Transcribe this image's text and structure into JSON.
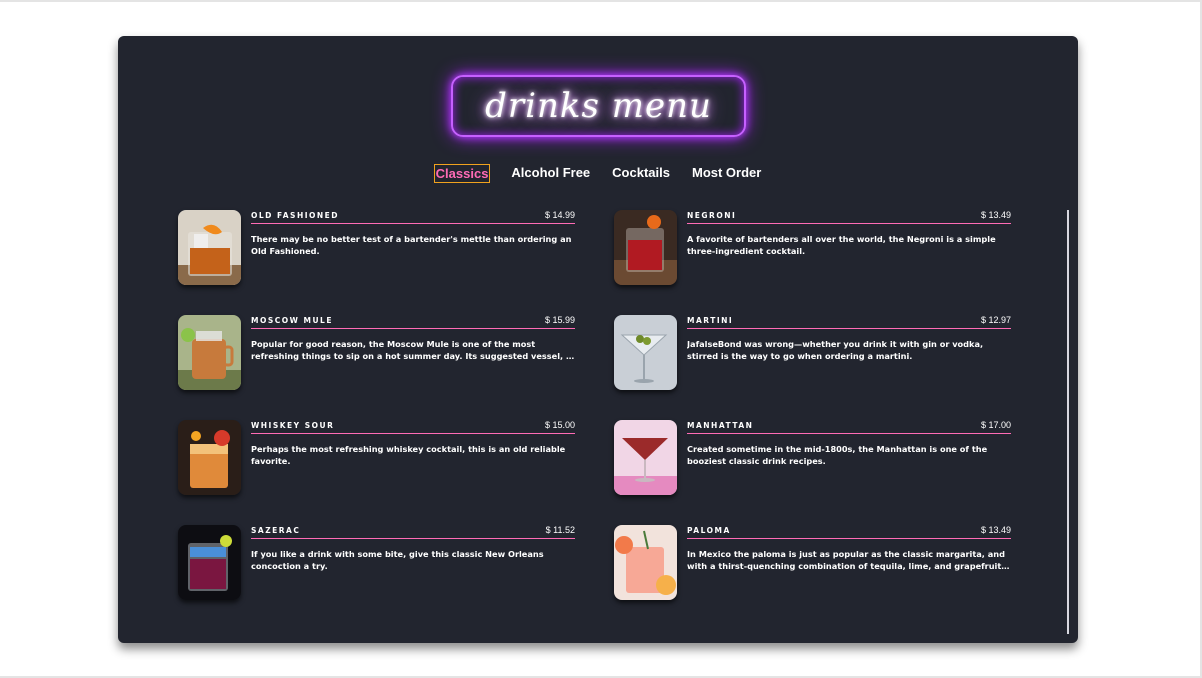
{
  "title": "drinks menu",
  "tabs": [
    {
      "label": "Classics",
      "active": true
    },
    {
      "label": "Alcohol Free",
      "active": false
    },
    {
      "label": "Cocktails",
      "active": false
    },
    {
      "label": "Most Order",
      "active": false
    }
  ],
  "colors": {
    "card_bg": "#22252f",
    "accent_pink": "#ff6bb5",
    "neon_purple": "#c660ff",
    "active_tab_border": "#f0a21e"
  },
  "items": [
    {
      "name": "OLD FASHIONED",
      "price": "$ 14.99",
      "desc": "There may be no better test of a bartender's mettle than ordering an Old Fashioned.",
      "icon": "old-fashioned-photo"
    },
    {
      "name": "NEGRONI",
      "price": "$ 13.49",
      "desc": "A favorite of bartenders all over the world, the Negroni is a simple three-ingredient cocktail.",
      "icon": "negroni-photo"
    },
    {
      "name": "MOSCOW MULE",
      "price": "$ 15.99",
      "desc": "Popular for good reason, the Moscow Mule is one of the most refreshing things to sip on a hot summer day. Its suggested vessel, a copper mug, also keeps it cold.",
      "icon": "moscow-mule-photo"
    },
    {
      "name": "MARTINI",
      "price": "$ 12.97",
      "desc": "JafalseBond was wrong—whether you drink it with gin or vodka, stirred is the way to go when ordering a martini.",
      "icon": "martini-photo"
    },
    {
      "name": "WHISKEY SOUR",
      "price": "$ 15.00",
      "desc": "Perhaps the most refreshing whiskey cocktail, this is an old reliable favorite.",
      "icon": "whiskey-sour-photo"
    },
    {
      "name": "MANHATTAN",
      "price": "$ 17.00",
      "desc": "Created sometime in the mid-1800s, the Manhattan is one of the booziest classic drink recipes.",
      "icon": "manhattan-photo"
    },
    {
      "name": "SAZERAC",
      "price": "$ 11.52",
      "desc": "If you like a drink with some bite, give this classic New Orleans concoction a try.",
      "icon": "sazerac-photo"
    },
    {
      "name": "PALOMA",
      "price": "$ 13.49",
      "desc": "In Mexico the paloma is just as popular as the classic margarita, and with a thirst-quenching combination of tequila, lime, and grapefruit soda it's bound to please.",
      "icon": "paloma-photo"
    }
  ]
}
